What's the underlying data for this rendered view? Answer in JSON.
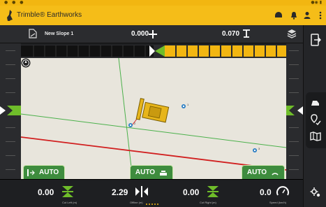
{
  "system_bar": {
    "left_icons": "● ● ●",
    "right_icons": "●◉ ▮"
  },
  "app": {
    "title": "Trimble® Earthworks",
    "accent_color": "#f5bd18",
    "icons": [
      "connection-icon",
      "alert-icon",
      "account-icon",
      "more-menu-icon"
    ]
  },
  "toolbar": {
    "design_name": "New Slope 1",
    "value_cross": "0.000",
    "value_target": "0.070"
  },
  "guidance": {
    "left_auto": "AUTO",
    "center_auto": "AUTO",
    "right_auto": "AUTO"
  },
  "status": {
    "cut_left": {
      "value": "0.00",
      "label": "Cut Left (m)"
    },
    "offline": {
      "value": "2.29",
      "label": "Offline (m)"
    },
    "cut_right": {
      "value": "0.00",
      "label": "Cut Right (m)"
    },
    "speed": {
      "value": "0.0",
      "label": "Speed (km/h)"
    }
  },
  "colors": {
    "grade_on": "#6fbd2a",
    "grade_high": "#f2b611",
    "offline_line": "#d11f1f",
    "guide_line": "#4bb14b",
    "point_marker": "#2d7fc4",
    "machine": "#e7b51b"
  },
  "lightbar": {
    "grade_level_fraction": 0.5
  },
  "map_points": [
    "1",
    "2",
    "3"
  ]
}
